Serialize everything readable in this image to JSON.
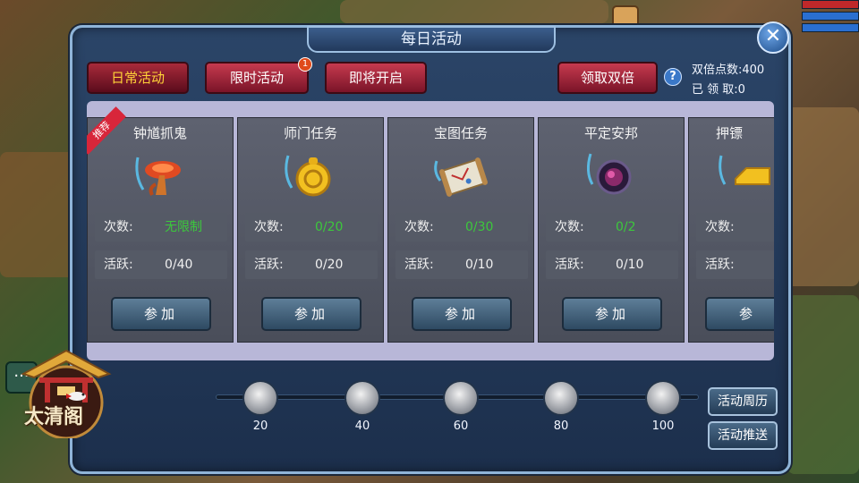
{
  "window": {
    "title": "每日活动",
    "close_icon": "close-icon"
  },
  "tabs": [
    {
      "label": "日常活动",
      "active": true
    },
    {
      "label": "限时活动",
      "badge": "1"
    },
    {
      "label": "即将开启"
    }
  ],
  "double": {
    "button_label": "领取双倍",
    "help_glyph": "?",
    "points_label": "双倍点数:",
    "points_value": "400",
    "claimed_label": "已 领 取:",
    "claimed_value": "0"
  },
  "cards": [
    {
      "name": "钟馗抓鬼",
      "ribbon": "推荐",
      "icon": "mushroom-icon",
      "count_label": "次数:",
      "count_value": "无限制",
      "active_label": "活跃:",
      "active_value": "0/40",
      "join_label": "参加"
    },
    {
      "name": "师门任务",
      "icon": "gold-coin-icon",
      "count_label": "次数:",
      "count_value": "0/20",
      "active_label": "活跃:",
      "active_value": "0/20",
      "join_label": "参加"
    },
    {
      "name": "宝图任务",
      "icon": "treasure-map-icon",
      "count_label": "次数:",
      "count_value": "0/30",
      "active_label": "活跃:",
      "active_value": "0/10",
      "join_label": "参加"
    },
    {
      "name": "平定安邦",
      "icon": "dark-orb-icon",
      "count_label": "次数:",
      "count_value": "0/2",
      "active_label": "活跃:",
      "active_value": "0/10",
      "join_label": "参加"
    },
    {
      "name": "押镖",
      "icon": "gold-bar-icon",
      "count_label": "次数:",
      "count_value": "",
      "active_label": "活跃:",
      "active_value": "",
      "join_label": "参"
    }
  ],
  "pavilion": {
    "name": "太清阁"
  },
  "milestones": [
    "20",
    "40",
    "60",
    "80",
    "100"
  ],
  "side_buttons": {
    "calendar": "活动周历",
    "push": "活动推送"
  },
  "chat_glyph": "···",
  "colors": {
    "green_value": "#3cc83c",
    "active_tab_text": "#ffd338",
    "tab_red": "#c63a4f"
  }
}
